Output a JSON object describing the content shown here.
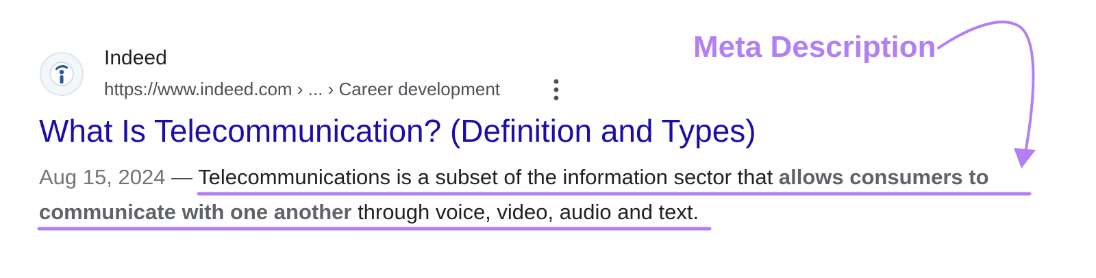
{
  "result": {
    "favicon_icon": "indeed-info-icon",
    "site_name": "Indeed",
    "url_breadcrumb": "https://www.indeed.com › ... › Career development",
    "more_icon": "more-vert-icon",
    "title": "What Is Telecommunication? (Definition and Types)",
    "date": "Aug 15, 2024",
    "separator": " — ",
    "snippet_part1": "Telecommunications is a subset of the information sector that ",
    "snippet_bold": "allows consumers to communicate with one another",
    "snippet_part2": " through voice, video, audio and text."
  },
  "annotation": {
    "label": "Meta Description",
    "arrow_icon": "curved-arrow-icon"
  },
  "colors": {
    "title_link": "#1a0dab",
    "annotation": "#b27ff5",
    "underline": "#b27ff5",
    "body_text": "#202124",
    "muted_text": "#70757a"
  }
}
